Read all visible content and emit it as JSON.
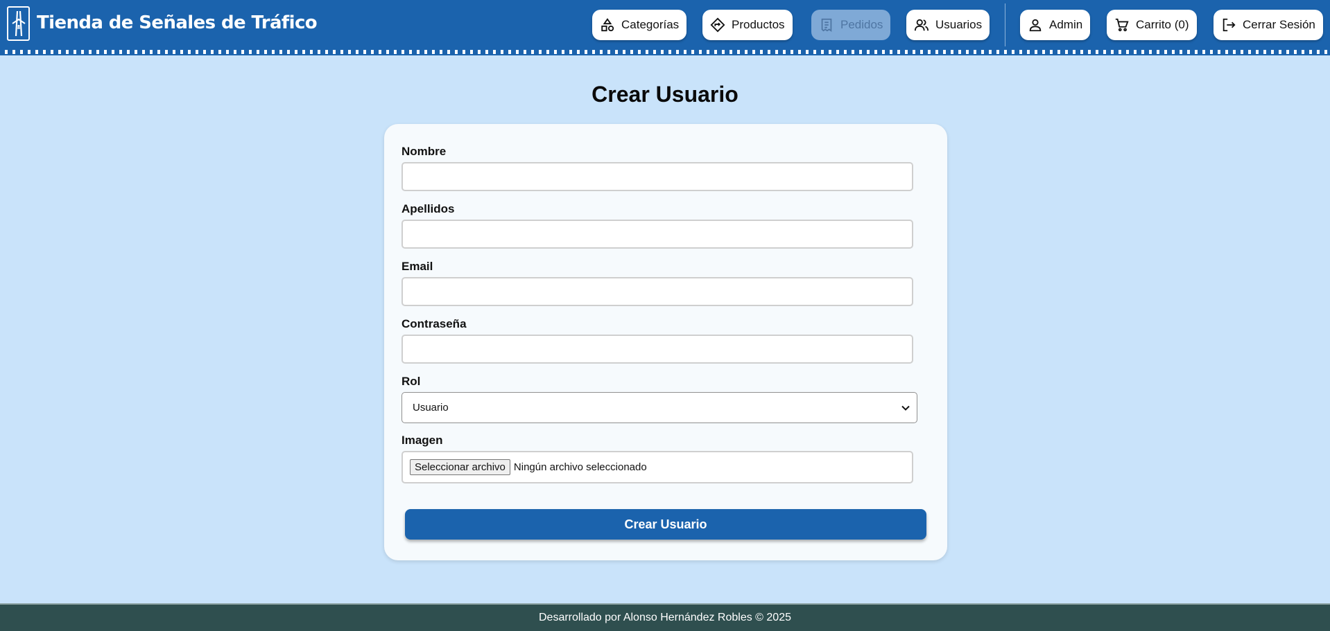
{
  "header": {
    "brand": "Tienda de Señales de Tráfico",
    "logo_icon": "highway-sign-icon",
    "nav": {
      "categorias": "Categorías",
      "productos": "Productos",
      "pedidos": "Pedidos",
      "usuarios": "Usuarios",
      "admin": "Admin",
      "carrito": "Carrito (0)",
      "logout": "Cerrar Sesión"
    }
  },
  "main": {
    "title": "Crear Usuario",
    "form": {
      "nombre_label": "Nombre",
      "nombre_value": "",
      "apellidos_label": "Apellidos",
      "apellidos_value": "",
      "email_label": "Email",
      "email_value": "",
      "password_label": "Contraseña",
      "password_value": "",
      "rol_label": "Rol",
      "rol_selected": "Usuario",
      "imagen_label": "Imagen",
      "file_button": "Seleccionar archivo",
      "file_status": "Ningún archivo seleccionado",
      "submit_label": "Crear Usuario"
    }
  },
  "footer": {
    "text": "Desarrollado por Alonso Hernández Robles © 2025"
  },
  "colors": {
    "primary": "#1b63ad",
    "background": "#c9e3fa",
    "card": "#f6fafd",
    "footer": "#2f4f4f"
  }
}
